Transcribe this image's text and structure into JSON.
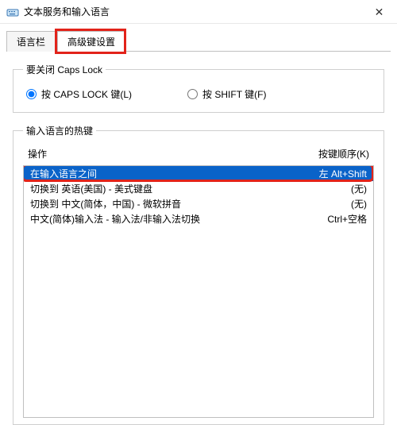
{
  "titlebar": {
    "title": "文本服务和输入语言",
    "close_glyph": "✕"
  },
  "tabs": [
    {
      "label": "语言栏",
      "active": false
    },
    {
      "label": "高级键设置",
      "active": true
    }
  ],
  "caps_group": {
    "legend": "要关闭 Caps Lock",
    "opt1_label": "按 CAPS LOCK 键(L)",
    "opt2_label": "按 SHIFT 键(F)"
  },
  "hotkey_group": {
    "legend": "输入语言的热键",
    "header_action": "操作",
    "header_keys": "按键顺序(K)",
    "rows": [
      {
        "action": "在输入语言之间",
        "keys": "左 Alt+Shift",
        "selected": true
      },
      {
        "action": "切换到 英语(美国) - 美式键盘",
        "keys": "(无)",
        "selected": false
      },
      {
        "action": "切换到 中文(简体，中国) - 微软拼音",
        "keys": "(无)",
        "selected": false
      },
      {
        "action": "中文(简体)输入法 - 输入法/非输入法切换",
        "keys": "Ctrl+空格",
        "selected": false
      }
    ]
  }
}
